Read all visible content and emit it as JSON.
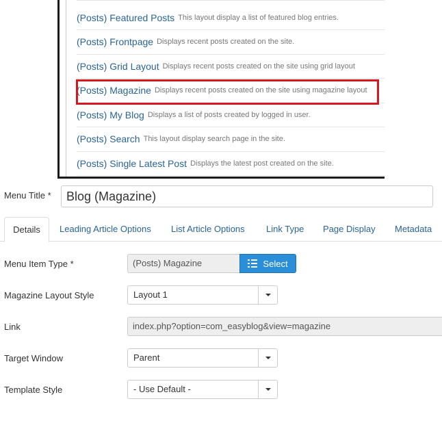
{
  "layouts": [
    {
      "title": "(Posts) Featured Posts",
      "desc": "This layout display a list of featured blog entries."
    },
    {
      "title": "(Posts) Frontpage",
      "desc": "Displays recent posts created on the site."
    },
    {
      "title": "(Posts) Grid Layout",
      "desc": "Displays recent posts created on the site using grid layout"
    },
    {
      "title": "(Posts) Magazine",
      "desc": "Displays recent posts created on the site using magazine layout"
    },
    {
      "title": "(Posts) My Blog",
      "desc": "Displays a list of posts created by logged in user."
    },
    {
      "title": "(Posts) Search",
      "desc": "This layout display search page in the site."
    },
    {
      "title": "(Posts) Single Latest Post",
      "desc": "Displays the latest post created on the site."
    }
  ],
  "highlight_color": "#d7171f",
  "menu_title": {
    "label": "Menu Title *",
    "value": "Blog (Magazine)"
  },
  "tabs": [
    "Details",
    "Leading Article Options",
    "List Article Options",
    "Link Type",
    "Page Display",
    "Metadata"
  ],
  "form": {
    "menu_item_type": {
      "label": "Menu Item Type *",
      "value": "(Posts) Magazine",
      "button": "Select",
      "button_icon": "list-icon"
    },
    "magazine_layout_style": {
      "label": "Magazine Layout Style",
      "value": "Layout 1"
    },
    "link": {
      "label": "Link",
      "value": "index.php?option=com_easyblog&view=magazine"
    },
    "target_window": {
      "label": "Target Window",
      "value": "Parent"
    },
    "template_style": {
      "label": "Template Style",
      "value": "- Use Default -"
    }
  },
  "colors": {
    "link": "#2a6496",
    "primary_button": "#2a8fd8"
  }
}
